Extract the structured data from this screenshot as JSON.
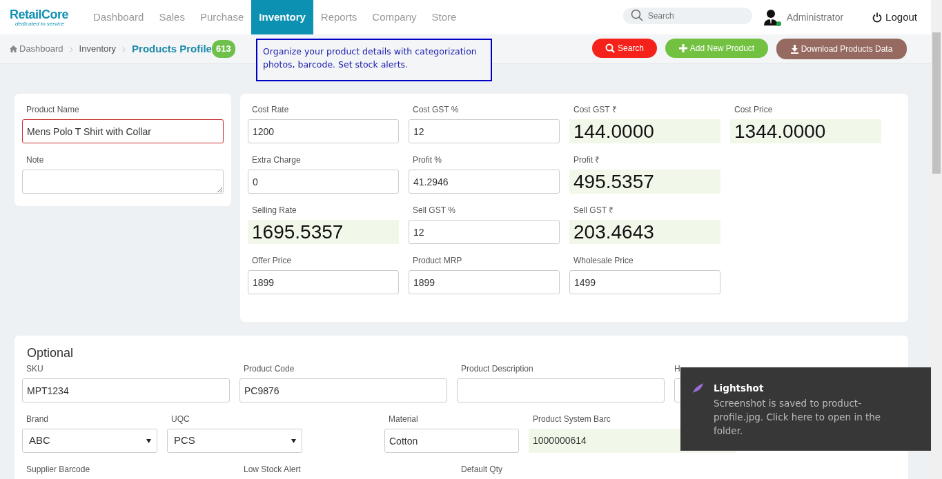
{
  "brand": {
    "name": "RetailCore",
    "tagline": "dedicated to service"
  },
  "nav": [
    {
      "label": "Dashboard",
      "selected": false
    },
    {
      "label": "Sales",
      "selected": false
    },
    {
      "label": "Purchase",
      "selected": false
    },
    {
      "label": "Inventory",
      "selected": true
    },
    {
      "label": "Reports",
      "selected": false
    },
    {
      "label": "Company",
      "selected": false
    },
    {
      "label": "Store",
      "selected": false
    }
  ],
  "search": {
    "placeholder": "Search"
  },
  "user": {
    "name": "Administrator",
    "online": true
  },
  "logout": "Logout",
  "breadcrumb": [
    {
      "label": "Dashboard",
      "kind": "home"
    },
    {
      "label": "Inventory",
      "kind": "plain"
    }
  ],
  "current": {
    "label": "Products Profile",
    "count": "613"
  },
  "info_note": "Organize your product details with categorization photos, barcode. Set stock alerts.",
  "actions": [
    {
      "label": "Search",
      "kind": "search"
    },
    {
      "label": "Add New Product",
      "kind": "add"
    },
    {
      "label": "Download Products Data",
      "kind": "download"
    }
  ],
  "basic_fields": [
    {
      "label": "Product Name",
      "value": "Mens Polo T Shirt with Collar",
      "kind": "text",
      "invalid": true
    },
    {
      "label": "Note",
      "kind": "textarea",
      "invalid": false
    }
  ],
  "pricing_rows": [
    [
      {
        "label": "Cost Rate",
        "value": "1200",
        "kind": "input"
      },
      {
        "label": "Cost GST %",
        "value": "12",
        "kind": "input"
      },
      {
        "label": "Cost GST ₹",
        "value": "144.0000",
        "kind": "computed"
      },
      {
        "label": "Cost Price",
        "value": "1344.0000",
        "kind": "computed"
      }
    ],
    [
      {
        "label": "Extra Charge",
        "value": "0",
        "kind": "input"
      },
      {
        "label": "Profit %",
        "value": "41.2946",
        "kind": "input"
      },
      {
        "label": "Profit ₹",
        "value": "495.5357",
        "kind": "computed"
      }
    ],
    [
      {
        "label": "Selling Rate",
        "value": "1695.5357",
        "kind": "computed"
      },
      {
        "label": "Sell GST %",
        "value": "12",
        "kind": "input"
      },
      {
        "label": "Sell GST ₹",
        "value": "203.4643",
        "kind": "computed"
      }
    ],
    [
      {
        "label": "Offer Price",
        "value": "1899",
        "kind": "input"
      },
      {
        "label": "Product MRP",
        "value": "1899",
        "kind": "input"
      },
      {
        "label": "Wholesale Price",
        "value": "1499",
        "kind": "input"
      }
    ]
  ],
  "optional": {
    "title": "Optional",
    "rows": [
      [
        {
          "label": "SKU",
          "value": "MPT1234",
          "kind": "text"
        },
        {
          "label": "Product Code",
          "value": "PC9876",
          "kind": "text"
        },
        {
          "label": "Product Description",
          "kind": "text"
        },
        {
          "label": "H",
          "kind": "text"
        }
      ],
      [
        {
          "label": "Brand",
          "value": "ABC",
          "kind": "select"
        },
        {
          "label": "UQC",
          "value": "PCS",
          "kind": "select"
        },
        {
          "label": "Material",
          "value": "Cotton",
          "kind": "text"
        },
        {
          "label": "Product System Barc",
          "value": "1000000614",
          "kind": "computed"
        }
      ],
      [
        {
          "label": "Supplier Barcode",
          "kind": "hidden"
        },
        {
          "label": "Low Stock Alert",
          "kind": "hidden"
        },
        {
          "label": "Default Qty",
          "kind": "hidden"
        }
      ]
    ]
  },
  "toast": {
    "title": "Lightshot",
    "message": "Screenshot is saved to product-profile.jpg. Click here to open in the folder."
  }
}
